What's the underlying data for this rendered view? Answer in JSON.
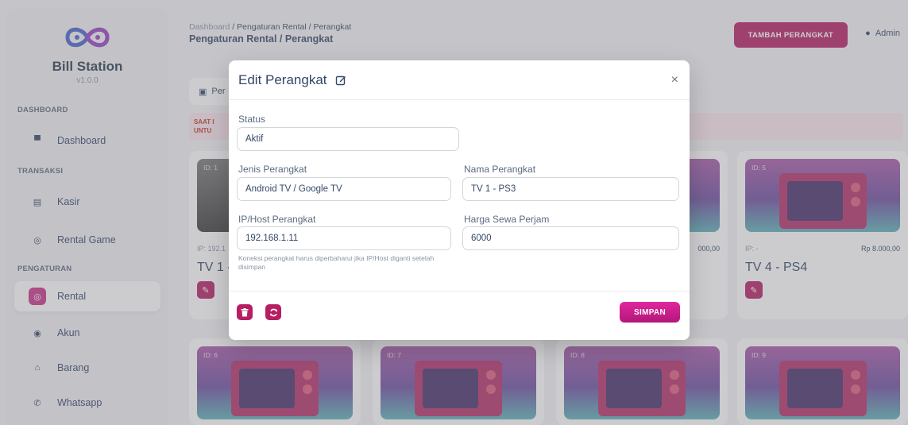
{
  "sidebar": {
    "brand_name": "Bill Station",
    "version": "v1.0.0",
    "sections": {
      "dashboard": "DASHBOARD",
      "transaksi": "TRANSAKSI",
      "pengaturan": "PENGATURAN"
    },
    "items": {
      "dashboard": "Dashboard",
      "kasir": "Kasir",
      "rental_game": "Rental Game",
      "rental": "Rental",
      "akun": "Akun",
      "barang": "Barang",
      "whatsapp": "Whatsapp"
    },
    "active_item": "Rental"
  },
  "header": {
    "breadcrumb_root": "Dashboard",
    "breadcrumb_rest": " / Pengaturan Rental / Perangkat",
    "page_title": "Pengaturan Rental / Perangkat",
    "add_button": "TAMBAH PERANGKAT",
    "user": "Admin"
  },
  "background": {
    "tab_label": "Per",
    "alert_line1": "SAAT I",
    "alert_line2": "UNTU",
    "cards": {
      "c1": {
        "id": "ID: 1",
        "ip": "IP: 192.1",
        "name": "TV 1 -"
      },
      "c5": {
        "id": "ID: 5",
        "ip": "IP: -",
        "price": "Rp 8.000,00",
        "name": "TV 4 - PS4"
      },
      "c4_price": "000,00",
      "c6": {
        "id": "ID: 6"
      },
      "c7": {
        "id": "ID: 7"
      },
      "c8": {
        "id": "ID: 8"
      },
      "c9": {
        "id": "ID: 9"
      }
    }
  },
  "modal": {
    "title": "Edit Perangkat",
    "close": "×",
    "status_label": "Status",
    "status_value": "Aktif",
    "jenis_label": "Jenis Perangkat",
    "jenis_value": "Android TV / Google TV",
    "nama_label": "Nama Perangkat",
    "nama_value": "TV 1 - PS3",
    "ip_label": "IP/Host Perangkat",
    "ip_value": "192.168.1.11",
    "harga_label": "Harga Sewa Perjam",
    "harga_value": "6000",
    "hint": "Koneksi perangkat harus diperbaharui jika IP/Host diganti setelah disimpan",
    "save_button": "SIMPAN"
  },
  "colors": {
    "accent": "#b71f63",
    "save_gradient_top": "#e0279d",
    "overlay": "rgba(120,120,130,.38)"
  }
}
